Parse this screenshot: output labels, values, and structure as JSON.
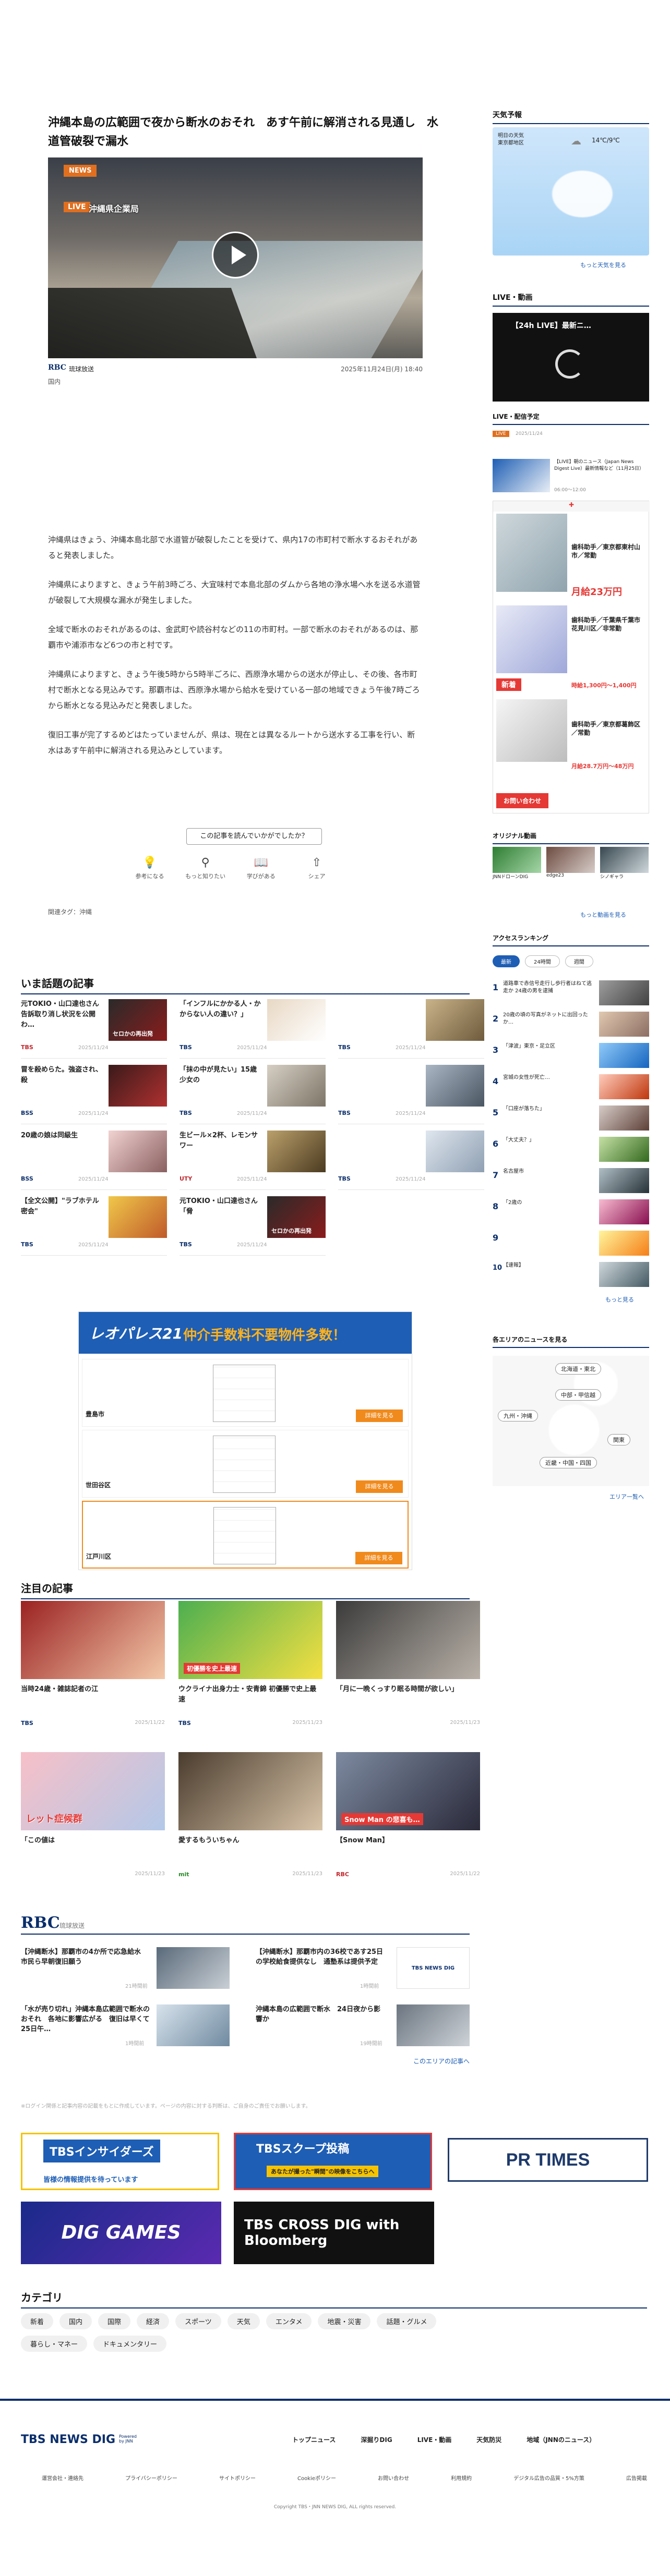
{
  "article": {
    "title": "沖縄本島の広範囲で夜から断水のおそれ　あす午前に解消される見通し　水道管破裂で漏水",
    "badge": "NEWS",
    "live_tag": "LIVE",
    "location_caption": "沖縄県企業局",
    "source": "琉球放送",
    "date": "2025年11月24日(月) 18:40",
    "share": "国内",
    "paragraphs": [
      "沖縄県はきょう、沖縄本島北部で水道管が破裂したことを受けて、県内17の市町村で断水するおそれがあると発表しました。",
      "沖縄県によりますと、きょう午前3時ごろ、大宜味村で本島北部のダムから各地の浄水場へ水を送る水道管が破裂して大規模な漏水が発生しました。",
      "全域で断水のおそれがあるのは、金武町や読谷村などの11の市町村。一部で断水のおそれがあるのは、那覇市や浦添市など6つの市と村です。",
      "沖縄県によりますと、きょう午後5時から5時半ごろに、西原浄水場からの送水が停止し、その後、各市町村で断水となる見込みです。那覇市は、西原浄水場から給水を受けている一部の地域できょう午後7時ごろから断水となる見込みだと発表しました。",
      "復旧工事が完了するめどはたっていませんが、県は、現在とは異なるルートから送水する工事を行い、断水はあす午前中に解消される見込みとしています。"
    ],
    "feedback_question": "この記事を読んでいかがでしたか？",
    "reactions": [
      "参考になる",
      "もっと知りたい",
      "学びがある",
      "シェア"
    ],
    "related_tags": "関連タグ：沖縄"
  },
  "sidebar": {
    "weather_title": "天気予報",
    "weather_label": "明日の天気\n東京都地区",
    "weather_temp": "14℃/9℃",
    "weather_more": "もっと天気を見る",
    "live_title": "LIVE・動画",
    "live_label": "【24h LIVE】最新ニ…",
    "schedule_title": "LIVE・配信予定",
    "schedule_badge": "LIVE",
    "schedule_date": "2025/11/24",
    "schedule_item": "【LIVE】朝のニュース（Japan News Digest Live）最新情報など（11月25日）",
    "schedule_time": "06:00～12:00",
    "ad_lines": [
      "歯科助手／東京都東村山市／常勤",
      "月給23万円",
      "歯科助手／千葉県千葉市花見川区／非常勤",
      "新着",
      "時給1,300円～1,400円",
      "歯科助手／東京都葛飾区／常勤",
      "月給28.7万円～48万円",
      "お問い合わせ"
    ],
    "original_title": "オリジナル動画",
    "originals": [
      "JNNドローンDIG",
      "edge23",
      "シノギャラ"
    ],
    "original_more": "もっと動画を見る",
    "ranking_title": "アクセスランキング",
    "ranking_tabs": [
      "最新",
      "24時間",
      "週間"
    ],
    "ranking": [
      "道路車で赤信号走行し歩行者はねて逃走か 24歳の男を逮捕",
      "20歳の頃の写真がネットに出回ったか…",
      "「津波」東京・足立区",
      "宮城の女性が死亡…",
      "「口座が落ちた」",
      "「大丈夫？」",
      "名古屋市",
      "「2歳の",
      "",
      "【速報】"
    ],
    "ranking_more": "もっと見る",
    "area_title": "各エリアのニュースを見る",
    "areas": [
      "北海道・東北",
      "中部・甲信越",
      "九州・沖縄",
      "関東",
      "近畿・中国・四国"
    ],
    "area_more": "エリア一覧へ"
  },
  "topics": {
    "title": "いま話題の記事",
    "items": [
      {
        "title": "元TOKIO・山口達也さん　告訴取り消し状況を公開わ…",
        "src": "TBS",
        "time": "2025/11/24",
        "thumb": "セロかの再出発"
      },
      {
        "title": "「インフルにかかる人・かからない人の違い？」",
        "src": "TBS",
        "time": "2025/11/24",
        "thumb": ""
      },
      {
        "title": "",
        "src": "TBS",
        "time": "2025/11/24",
        "thumb": ""
      },
      {
        "title": "冒を殺めらた。強盗され、殺",
        "src": "BSS",
        "time": "2025/11/24",
        "thumb": ""
      },
      {
        "title": "「抹の中が見たい」15歳少女の",
        "src": "TBS",
        "time": "2025/11/24",
        "thumb": ""
      },
      {
        "title": "",
        "src": "TBS",
        "time": "2025/11/24",
        "thumb": ""
      },
      {
        "title": "20歳の娘は同級生",
        "src": "BSS",
        "time": "2025/11/24",
        "thumb": ""
      },
      {
        "title": "生ビール×2杯、レモンサワー",
        "src": "UTY",
        "time": "2025/11/24",
        "thumb": ""
      },
      {
        "title": "",
        "src": "TBS",
        "time": "2025/11/24",
        "thumb": ""
      },
      {
        "title": "【全文公開】\"ラブホテル密会\"",
        "src": "TBS",
        "time": "2025/11/24",
        "thumb": ""
      },
      {
        "title": "元TOKIO・山口達也さん「脅",
        "src": "TBS",
        "time": "2025/11/24",
        "thumb": "セロかの再出発"
      },
      {
        "title": "",
        "src": "",
        "time": "",
        "thumb": ""
      }
    ]
  },
  "ad": {
    "logo": "レオパレス21",
    "catch": "仲介手数料不要物件多数！",
    "items": [
      {
        "label": "豊島市",
        "btn": "詳細を見る"
      },
      {
        "label": "世田谷区",
        "btn": "詳細を見る"
      },
      {
        "label": "江戸川区",
        "btn": "詳細を見る"
      }
    ]
  },
  "featured": {
    "title": "注目の記事",
    "items": [
      {
        "title": "当時24歳・雑誌記者の江",
        "src": "TBS",
        "time": "2025/11/22"
      },
      {
        "title": "ウクライナ出身力士・安青錦 初優勝で史上最速",
        "src": "TBS",
        "time": "2025/11/23"
      },
      {
        "title": "「月に一晩くっすり眠る時間が欲しい」",
        "src": "",
        "time": "2025/11/23"
      },
      {
        "title": "「この値は",
        "src": "",
        "time": "2025/11/23"
      },
      {
        "title": "愛するもういちゃん",
        "src": "mit",
        "time": "2025/11/23"
      },
      {
        "title": "【Snow Man】",
        "src": "RBC",
        "time": "2025/11/22"
      }
    ],
    "thumb_texts": [
      "",
      "初優勝を史上最速",
      "",
      "レット症候群",
      "",
      "Snow Man の悲喜も…"
    ]
  },
  "rbc": {
    "logo": "RBC",
    "sub": "琉球放送",
    "items": [
      {
        "title": "【沖縄断水】那覇市の4か所で応急給水　市民ら早朝復旧願う",
        "time": "21時間前"
      },
      {
        "title": "【沖縄断水】那覇市内の36校であす25日の学校給食提供なし　通塾系は提供予定",
        "time": "1時間前"
      },
      {
        "title": "「水が売り切れ」沖縄本島広範囲で断水のおそれ　各地に影響広がる　復旧は早くて25日午…",
        "time": "1時間前"
      },
      {
        "title": "沖縄本島の広範囲で断水　24日夜から影響か",
        "time": "19時間前"
      }
    ],
    "more": "このエリアの記事へ"
  },
  "notice": "※ログイン関係と記事内容の記載をもとに作成しています。ページの内容に対する判断は、ご自身のご責任でお願いします。",
  "banners": [
    "TBSインサイダーズ",
    "TBSスクープ投稿",
    "PR TIMES",
    "DIG GAMES",
    "TBS CROSS DIG with Bloomberg"
  ],
  "banner_sub": [
    "皆様の情報提供を待っています",
    "あなたが撮った\"瞬間\"の映像をこちらへ"
  ],
  "categories": {
    "title": "カテゴリ",
    "items": [
      "新着",
      "国内",
      "国際",
      "経済",
      "スポーツ",
      "天気",
      "エンタメ",
      "地震・災害",
      "話題・グルメ",
      "暮らし・マネー",
      "ドキュメンタリー"
    ]
  },
  "footer": {
    "logo": "TBS NEWS DIG",
    "powered": "Powered by JNN",
    "nav1": [
      "トップニュース",
      "深掘りDIG",
      "LIVE・動画",
      "天気防災",
      "地域（JNNのニュース）"
    ],
    "nav2": [
      "運営会社・連絡先",
      "プライバシーポリシー",
      "サイトポリシー",
      "Cookieポリシー",
      "お問い合わせ",
      "利用規約",
      "デジタル広告の品質・5%方策",
      "広告掲載"
    ],
    "copyright": "Copyright TBS・JNN NEWS DIG, ALL rights reserved."
  },
  "colors": {
    "brand_blue": "#0a2e6b",
    "accent_orange": "#e06f1f",
    "link_blue": "#1e5eb4"
  }
}
